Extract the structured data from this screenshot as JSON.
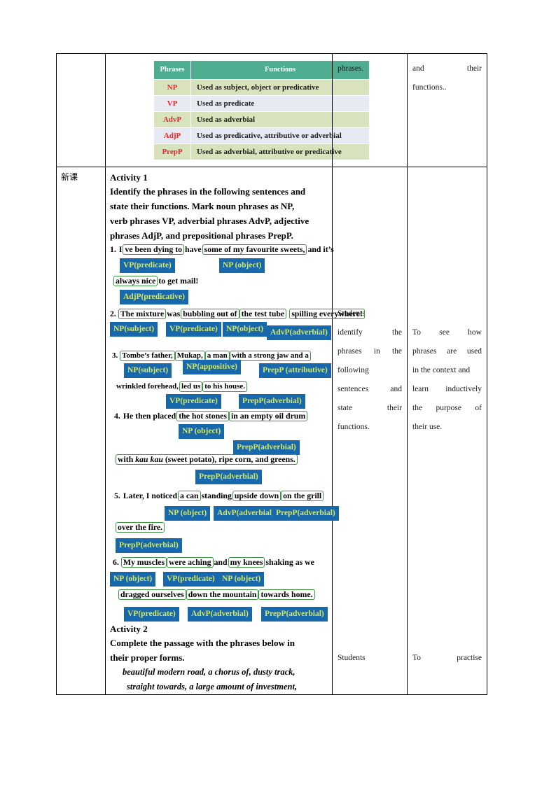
{
  "phrase_table": {
    "headers": [
      "Phrases",
      "Functions"
    ],
    "rows": [
      {
        "tag": "NP",
        "desc": "Used as subject, object or predicative"
      },
      {
        "tag": "VP",
        "desc": "Used as predicate"
      },
      {
        "tag": "AdvP",
        "desc": "Used as adverbial"
      },
      {
        "tag": "AdjP",
        "desc": "Used as predicative, attributive or adverbial"
      },
      {
        "tag": "PrepP",
        "desc": "Used as adverbial, attributive or  predicative"
      }
    ],
    "colors": {
      "header_bg": "#4FAE92",
      "row_a_bg": "#D8E3BE",
      "row_b_bg": "#E7EAF3",
      "tag_color": "#E8262C"
    }
  },
  "row1": {
    "activity_col": "phrases.",
    "aim_col_line1": "and                their",
    "aim_col_line2": "functions.."
  },
  "row2": {
    "stage": "新课",
    "activity_title": "Activity 1",
    "activity_intro_lines": [
      "Identify the phrases in the following sentences and",
      "state their functions. Mark  noun phrases as NP,",
      "verb phrases VP, adverbial phrases AdvP, adjective",
      "phrases AdjP,  and prepositional phrases PrepP."
    ],
    "students_col_lines": [
      "Students",
      "identify               the",
      "phrases   in     the",
      "following",
      "sentences        and",
      "state             their",
      "functions."
    ],
    "aim_col_lines": [
      "To      see     how",
      "phrases  are   used",
      "in the context and",
      "learn   inductively",
      "the    purpose    of",
      "their use."
    ],
    "activity2_title": "Activity 2",
    "activity2_intro_lines": [
      "Complete the passage with the phrases below in",
      "their proper forms."
    ],
    "activity2_word_bank_lines": [
      "beautiful modern road,  a chorus of,  dusty track,",
      "straight towards,  a large amount of investment,"
    ],
    "students_col2": "Students",
    "aim_col2": "To           practise"
  },
  "sentences": [
    {
      "number": "1.",
      "lines": [
        {
          "parts": [
            {
              "type": "plain",
              "text": "I"
            },
            {
              "type": "chunk",
              "text": "ve been dying to"
            },
            {
              "type": "plain",
              "text": "have"
            },
            {
              "type": "chunk",
              "text": "some of my favourite sweets,"
            },
            {
              "type": "plain",
              "text": "and it’s"
            }
          ]
        },
        {
          "parts": [
            {
              "type": "chunk",
              "text": "always nice"
            },
            {
              "type": "plain",
              "text": "to get mail!"
            }
          ]
        }
      ],
      "tags": [
        "VP(predicate)",
        "NP (object)",
        "AdjP(predicative)"
      ]
    },
    {
      "number": "2.",
      "lines": [
        {
          "parts": [
            {
              "type": "chunk",
              "text": "The mixture"
            },
            {
              "type": "plain",
              "text": "was"
            },
            {
              "type": "chunk",
              "text": "bubbling out of"
            },
            {
              "type": "chunk",
              "text": "the test tube"
            },
            {
              "type": "chunk",
              "text": "spilling everywhere!"
            }
          ]
        }
      ],
      "tags": [
        "NP(subject)",
        "VP(predicate)",
        "NP(object)",
        "AdvP(adverbial)"
      ]
    },
    {
      "number": "3.",
      "lines": [
        {
          "parts": [
            {
              "type": "chunk",
              "text": "Tombe’s father,"
            },
            {
              "type": "chunk",
              "text": "Mukap,"
            },
            {
              "type": "chunk",
              "text": "a man"
            },
            {
              "type": "chunk",
              "text": "with a strong jaw and a"
            }
          ]
        },
        {
          "parts": [
            {
              "type": "plain",
              "text": "wrinkled forehead,"
            },
            {
              "type": "chunk",
              "text": "led us"
            },
            {
              "type": "chunk",
              "text": "to his house."
            }
          ]
        }
      ],
      "tags": [
        "NP(subject)",
        "NP(appositive)",
        "PrepP (attributive)",
        "VP(predicate)",
        "PrepP(adverbial)"
      ]
    },
    {
      "number": "4.",
      "lines": [
        {
          "parts": [
            {
              "type": "plain",
              "text": "He then placed"
            },
            {
              "type": "chunk",
              "text": "the hot stones"
            },
            {
              "type": "chunk",
              "text": "in an empty oil drum"
            }
          ]
        },
        {
          "parts": [
            {
              "type": "chunk",
              "text": "with kau kau (sweet potato), ripe corn, and greens."
            }
          ]
        }
      ],
      "tags": [
        "NP (object)",
        "PrepP(adverbial)",
        "PrepP(adverbial)"
      ]
    },
    {
      "number": "5.",
      "lines": [
        {
          "parts": [
            {
              "type": "plain",
              "text": "Later, I noticed"
            },
            {
              "type": "chunk",
              "text": "a can"
            },
            {
              "type": "plain",
              "text": "standing"
            },
            {
              "type": "chunk",
              "text": "upside down"
            },
            {
              "type": "chunk",
              "text": "on the grill"
            }
          ]
        },
        {
          "parts": [
            {
              "type": "chunk",
              "text": "over the fire."
            }
          ]
        }
      ],
      "tags": [
        "NP (object)",
        "AdvP(adverbial)",
        "PrepP(adverbial)",
        "PrepP(adverbial)"
      ]
    },
    {
      "number": "6.",
      "lines": [
        {
          "parts": [
            {
              "type": "chunk",
              "text": "My muscles"
            },
            {
              "type": "chunk",
              "text": "were aching"
            },
            {
              "type": "plain",
              "text": "and"
            },
            {
              "type": "chunk",
              "text": "my knees"
            },
            {
              "type": "plain",
              "text": "shaking as we"
            }
          ]
        },
        {
          "parts": [
            {
              "type": "chunk",
              "text": "dragged ourselves"
            },
            {
              "type": "chunk",
              "text": "down the mountain"
            },
            {
              "type": "chunk",
              "text": "towards home."
            }
          ]
        }
      ],
      "tags": [
        "NP (object)",
        "VP(predicate)",
        "NP (object)",
        "VP(predicate)",
        "AdvP(adverbial)",
        "PrepP(adverbial)"
      ]
    }
  ],
  "s1": {
    "l1_a": "I",
    "l1_b": "ve been dying to",
    "l1_c": "have",
    "l1_d": "some of my favourite sweets,",
    "l1_e": "and it’s",
    "l2_a": "always nice",
    "l2_b": "to get mail!",
    "t1": "VP(predicate)",
    "t2": "NP (object)",
    "t3": "AdjP(predicative)"
  },
  "s2": {
    "a": "The mixture",
    "b": "was",
    "c": "bubbling out of",
    "d": "the test tube",
    "e": "spilling everywhere!",
    "t1": "NP(subject)",
    "t2": "VP(predicate)",
    "t3": "NP(object)",
    "t4": "AdvP(adverbial)"
  },
  "s3": {
    "a": "Tombe’s father,",
    "b": "Mukap,",
    "c": "a man",
    "d": "with a strong jaw and a",
    "e": "wrinkled forehead,",
    "f": "led us",
    "g": "to his house.",
    "t1": "NP(subject)",
    "t2": "NP(appositive)",
    "t3": "PrepP (attributive)",
    "t4": "VP(predicate)",
    "t5": "PrepP(adverbial)"
  },
  "s4": {
    "a": "He then placed",
    "b": "the hot stones",
    "c": "in an empty oil drum",
    "d1": "with ",
    "d2": "kau kau",
    "d3": " (sweet potato), ripe corn, and greens.",
    "t1": "NP (object)",
    "t2": "PrepP(adverbial)",
    "t3": "PrepP(adverbial)"
  },
  "s5": {
    "a": "Later, I noticed",
    "b": "a can",
    "c": "standing",
    "d": "upside down",
    "e": "on the grill",
    "f": "over the fire.",
    "t1": "NP (object)",
    "t2": "AdvP(adverbial)",
    "t3": "PrepP(adverbial)",
    "t4": "PrepP(adverbial)"
  },
  "s6": {
    "a": "My muscles",
    "b": "were aching",
    "c": "and",
    "d": "my knees",
    "e": "shaking as we",
    "f": "dragged ourselves",
    "g": "down the mountain",
    "h": "towards home.",
    "t1": "NP (object)",
    "t2": "VP(predicate)",
    "t3": "NP (object)",
    "t4": "VP(predicate)",
    "t5": "AdvP(adverbial)",
    "t6": "PrepP(adverbial)"
  }
}
